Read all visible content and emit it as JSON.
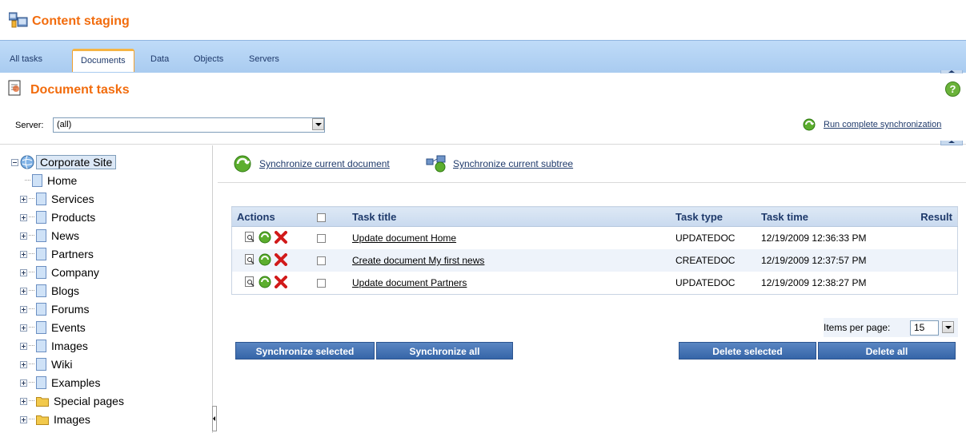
{
  "app": {
    "title": "Content staging"
  },
  "tabs": [
    {
      "label": "All tasks"
    },
    {
      "label": "Documents",
      "active": true
    },
    {
      "label": "Data"
    },
    {
      "label": "Objects"
    },
    {
      "label": "Servers"
    }
  ],
  "page": {
    "title": "Document tasks"
  },
  "server": {
    "label": "Server:",
    "selected": "(all)"
  },
  "run_sync": {
    "label": "Run complete synchronization"
  },
  "tree": {
    "root": "Corporate Site",
    "items": [
      {
        "label": "Home"
      },
      {
        "label": "Services"
      },
      {
        "label": "Products"
      },
      {
        "label": "News"
      },
      {
        "label": "Partners"
      },
      {
        "label": "Company"
      },
      {
        "label": "Blogs"
      },
      {
        "label": "Forums"
      },
      {
        "label": "Events"
      },
      {
        "label": "Images"
      },
      {
        "label": "Wiki"
      },
      {
        "label": "Examples"
      },
      {
        "label": "Special pages"
      },
      {
        "label": "Images"
      }
    ]
  },
  "sync_links": {
    "current_document": "Synchronize current document",
    "current_subtree": "Synchronize current subtree"
  },
  "table": {
    "headers": {
      "actions": "Actions",
      "task_title": "Task title",
      "task_type": "Task type",
      "task_time": "Task time",
      "result": "Result"
    },
    "rows": [
      {
        "title": "Update document Home",
        "type": "UPDATEDOC",
        "time": "12/19/2009 12:36:33 PM",
        "result": ""
      },
      {
        "title": "Create document My first news",
        "type": "CREATEDOC",
        "time": "12/19/2009 12:37:57 PM",
        "result": ""
      },
      {
        "title": "Update document Partners",
        "type": "UPDATEDOC",
        "time": "12/19/2009 12:38:27 PM",
        "result": ""
      }
    ]
  },
  "items_per_page": {
    "label": "Items per page:",
    "value": "15"
  },
  "buttons": {
    "sync_selected": "Synchronize selected",
    "sync_all": "Synchronize all",
    "delete_selected": "Delete selected",
    "delete_all": "Delete all"
  },
  "colors": {
    "accent": "#f26c0d",
    "tab_bar": "#bfdbf8",
    "button": "#3565a8"
  }
}
